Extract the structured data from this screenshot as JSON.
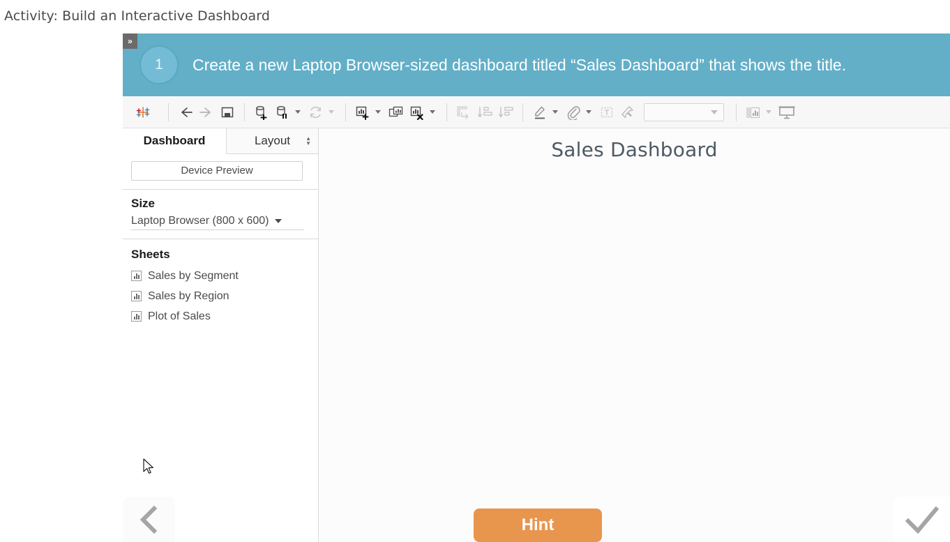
{
  "page": {
    "heading": "Activity: Build an Interactive Dashboard"
  },
  "banner": {
    "collapse_label": "»",
    "step_number": "1",
    "instruction": "Create a new Laptop Browser-sized dashboard titled “Sales Dashboard” that shows the title.",
    "background_color": "#63afc8",
    "circle_color": "#74bcd6"
  },
  "toolbar": {
    "items": [
      {
        "name": "tableau-logo-icon",
        "label": "Tableau"
      },
      {
        "name": "back-arrow-icon",
        "label": "Back"
      },
      {
        "name": "forward-arrow-icon",
        "label": "Forward"
      },
      {
        "name": "save-icon",
        "label": "Save"
      },
      {
        "name": "new-data-source-icon",
        "label": "New Data Source"
      },
      {
        "name": "pause-data-updates-icon",
        "label": "Pause Auto Updates"
      },
      {
        "name": "refresh-data-source-icon",
        "label": "Refresh Data Source"
      },
      {
        "name": "new-worksheet-icon",
        "label": "New Worksheet"
      },
      {
        "name": "duplicate-sheet-icon",
        "label": "Duplicate Sheet"
      },
      {
        "name": "clear-sheet-icon",
        "label": "Clear Sheet"
      },
      {
        "name": "swap-rows-columns-icon",
        "label": "Swap Rows and Columns"
      },
      {
        "name": "sort-ascending-icon",
        "label": "Sort Ascending"
      },
      {
        "name": "sort-descending-icon",
        "label": "Sort Descending"
      },
      {
        "name": "highlight-icon",
        "label": "Highlight"
      },
      {
        "name": "group-members-icon",
        "label": "Group Members"
      },
      {
        "name": "show-mark-labels-icon",
        "label": "Show Mark Labels"
      },
      {
        "name": "fix-axes-icon",
        "label": "Fix Axes"
      },
      {
        "name": "show-hide-cards-icon",
        "label": "Show/Hide Cards"
      },
      {
        "name": "presentation-mode-icon",
        "label": "Presentation Mode"
      }
    ],
    "fit_dropdown_value": ""
  },
  "sidebar": {
    "tabs": [
      {
        "label": "Dashboard",
        "active": true
      },
      {
        "label": "Layout",
        "active": false
      }
    ],
    "device_preview_label": "Device Preview",
    "size": {
      "title": "Size",
      "value": "Laptop Browser (800 x 600)"
    },
    "sheets": {
      "title": "Sheets",
      "items": [
        {
          "label": "Sales by Segment"
        },
        {
          "label": "Sales by Region"
        },
        {
          "label": "Plot of Sales"
        }
      ]
    }
  },
  "canvas": {
    "dashboard_title": "Sales Dashboard"
  },
  "footer": {
    "prev_label": "Previous",
    "hint_label": "Hint",
    "next_label": "Next",
    "hint_color": "#e8954e"
  }
}
